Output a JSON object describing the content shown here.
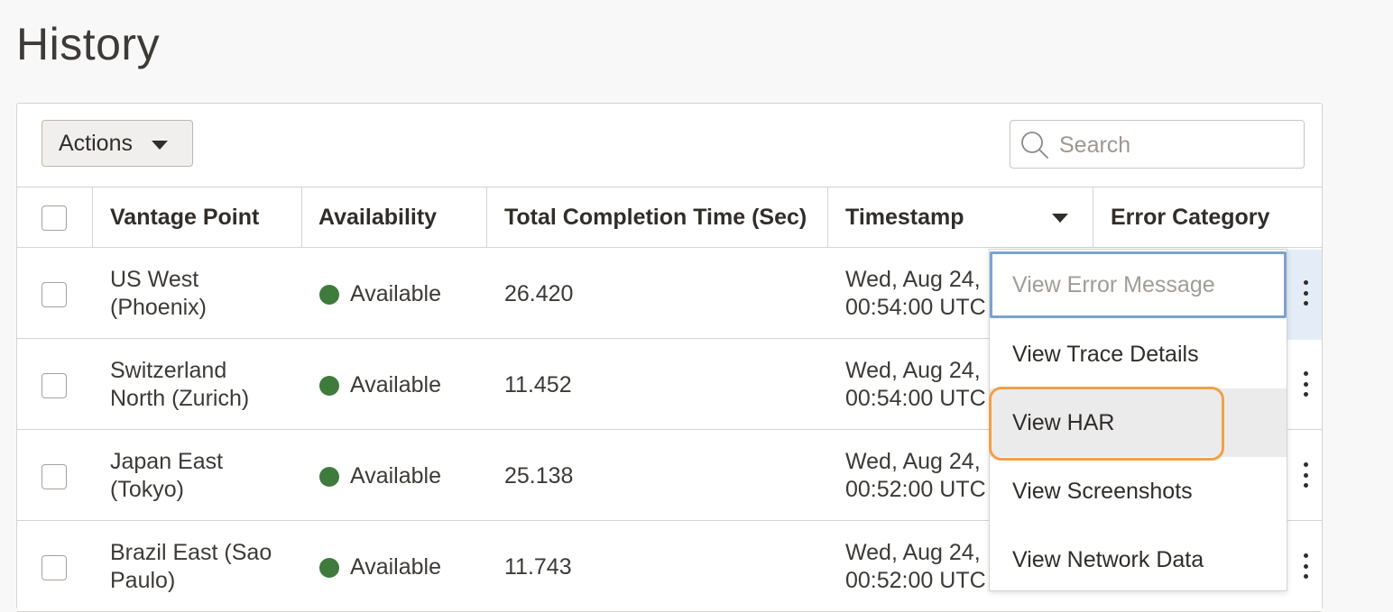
{
  "page": {
    "title": "History"
  },
  "toolbar": {
    "actions_label": "Actions",
    "search_placeholder": "Search"
  },
  "table": {
    "columns": [
      "Vantage Point",
      "Availability",
      "Total Completion Time (Sec)",
      "Timestamp",
      "Error Category"
    ],
    "rows": [
      {
        "vantage_line1": "US West",
        "vantage_line2": "(Phoenix)",
        "availability": "Available",
        "time": "26.420",
        "ts_line1": "Wed, Aug 24,",
        "ts_line2": "00:54:00 UTC"
      },
      {
        "vantage_line1": "Switzerland",
        "vantage_line2": "North (Zurich)",
        "availability": "Available",
        "time": "11.452",
        "ts_line1": "Wed, Aug 24,",
        "ts_line2": "00:54:00 UTC"
      },
      {
        "vantage_line1": "Japan East",
        "vantage_line2": "(Tokyo)",
        "availability": "Available",
        "time": "25.138",
        "ts_line1": "Wed, Aug 24,",
        "ts_line2": "00:52:00 UTC"
      },
      {
        "vantage_line1": "Brazil East (Sao",
        "vantage_line2": "Paulo)",
        "availability": "Available",
        "time": "11.743",
        "ts_line1": "Wed, Aug 24,",
        "ts_line2": "00:52:00 UTC"
      }
    ]
  },
  "menu": {
    "items": [
      {
        "label": "View Error Message",
        "disabled": true
      },
      {
        "label": "View Trace Details",
        "disabled": false
      },
      {
        "label": "View HAR",
        "disabled": false,
        "highlighted": true
      },
      {
        "label": "View Screenshots",
        "disabled": false
      },
      {
        "label": "View Network Data",
        "disabled": false
      }
    ]
  },
  "colors": {
    "available": "#3e7b3d",
    "focus_ring": "#f0a049",
    "disabled_item_border": "#7ba3cf"
  },
  "icons": {
    "search": "search-icon",
    "actions_caret": "caret-down-icon",
    "sort": "sort-desc-icon",
    "row_menu": "kebab-menu-icon"
  }
}
